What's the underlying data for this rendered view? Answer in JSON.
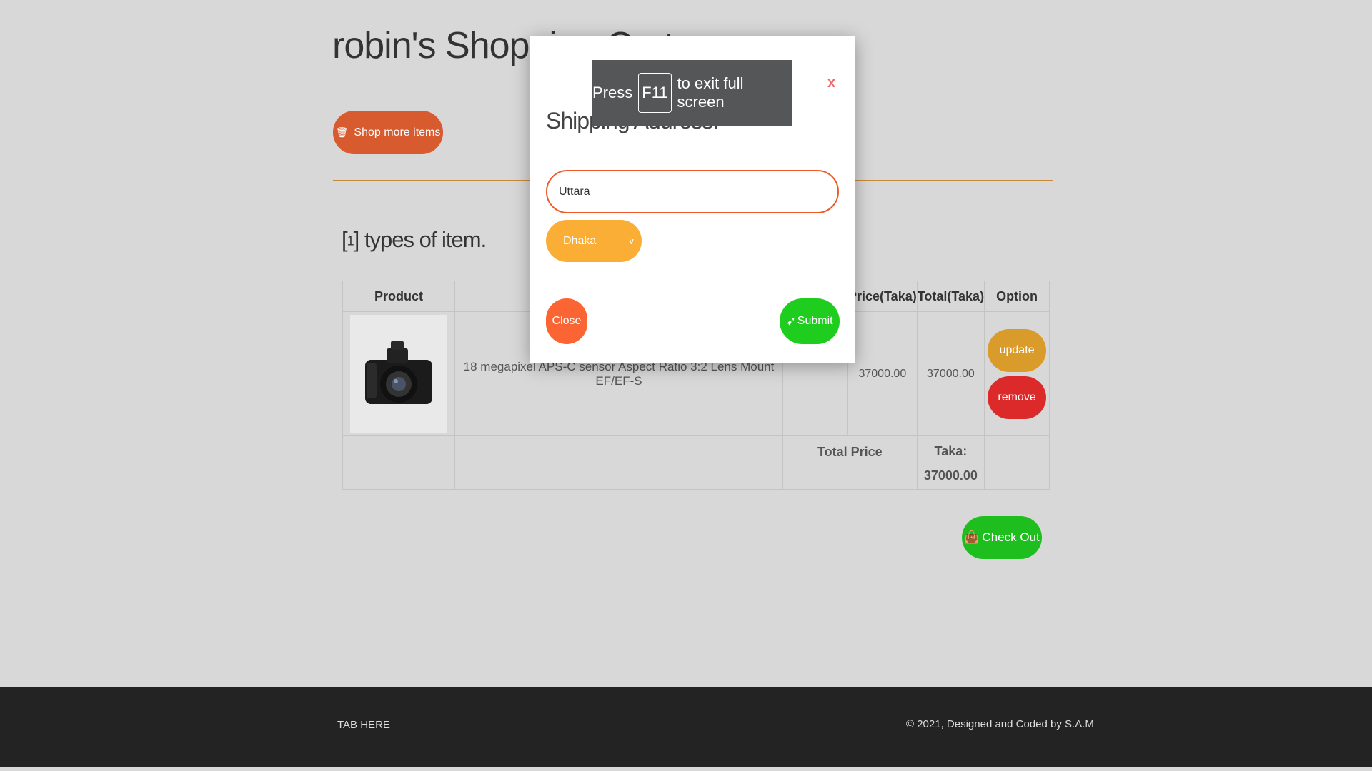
{
  "page": {
    "title": "robin's Shopping Cart",
    "shop_more_label": "Shop more items",
    "types_prefix": "[",
    "types_count": "1",
    "types_suffix": "] types of item."
  },
  "table": {
    "headers": {
      "product": "Product",
      "description": "",
      "quantity": "",
      "price": "Price(Taka)",
      "total": "Total(Taka)",
      "option": "Option"
    },
    "items": [
      {
        "image_icon": "camera-image",
        "description": "18 megapixel APS-C sensor Aspect Ratio 3:2 Lens Mount EF/EF-S",
        "price": "37000.00",
        "total": "37000.00",
        "update_label": "update",
        "remove_label": "remove"
      }
    ],
    "total_label": "Total Price",
    "total_currency": "Taka:",
    "total_value": "37000.00"
  },
  "checkout_label": "Check Out",
  "footer": {
    "tab_label": "TAB HERE",
    "copyright": "© 2021, Designed and Coded by S.A.M"
  },
  "modal": {
    "title": "Shipping Address:",
    "close_x": "x",
    "address_value": "Uttara",
    "city_selected": "Dhaka",
    "close_label": "Close",
    "submit_label": "Submit"
  },
  "toast": {
    "press": "Press",
    "key": "F11",
    "rest": "to exit full screen"
  },
  "colors": {
    "accent_orange": "#d85b2f",
    "update": "#d99b2a",
    "remove": "#dc2a2a",
    "checkout": "#1fbe1f",
    "city_select": "#fbae35",
    "footer_bg": "#232323"
  }
}
